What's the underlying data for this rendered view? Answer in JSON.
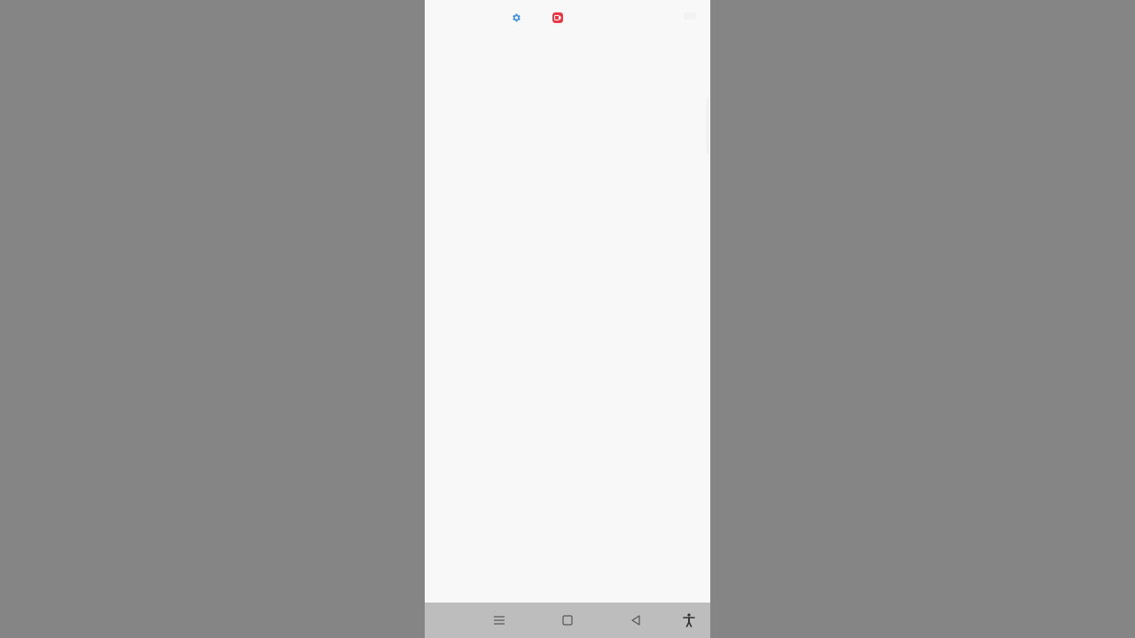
{
  "status_bar": {
    "icons": [
      "gear-icon",
      "screen-record-icon",
      "battery-icon"
    ],
    "gear_color": "#3b8ed8",
    "record_color": "#e53945"
  },
  "content": {
    "state": "blank"
  },
  "nav_bar": {
    "buttons": [
      "menu-icon",
      "home-icon",
      "back-icon",
      "accessibility-icon"
    ],
    "icon_color": "#555555"
  }
}
